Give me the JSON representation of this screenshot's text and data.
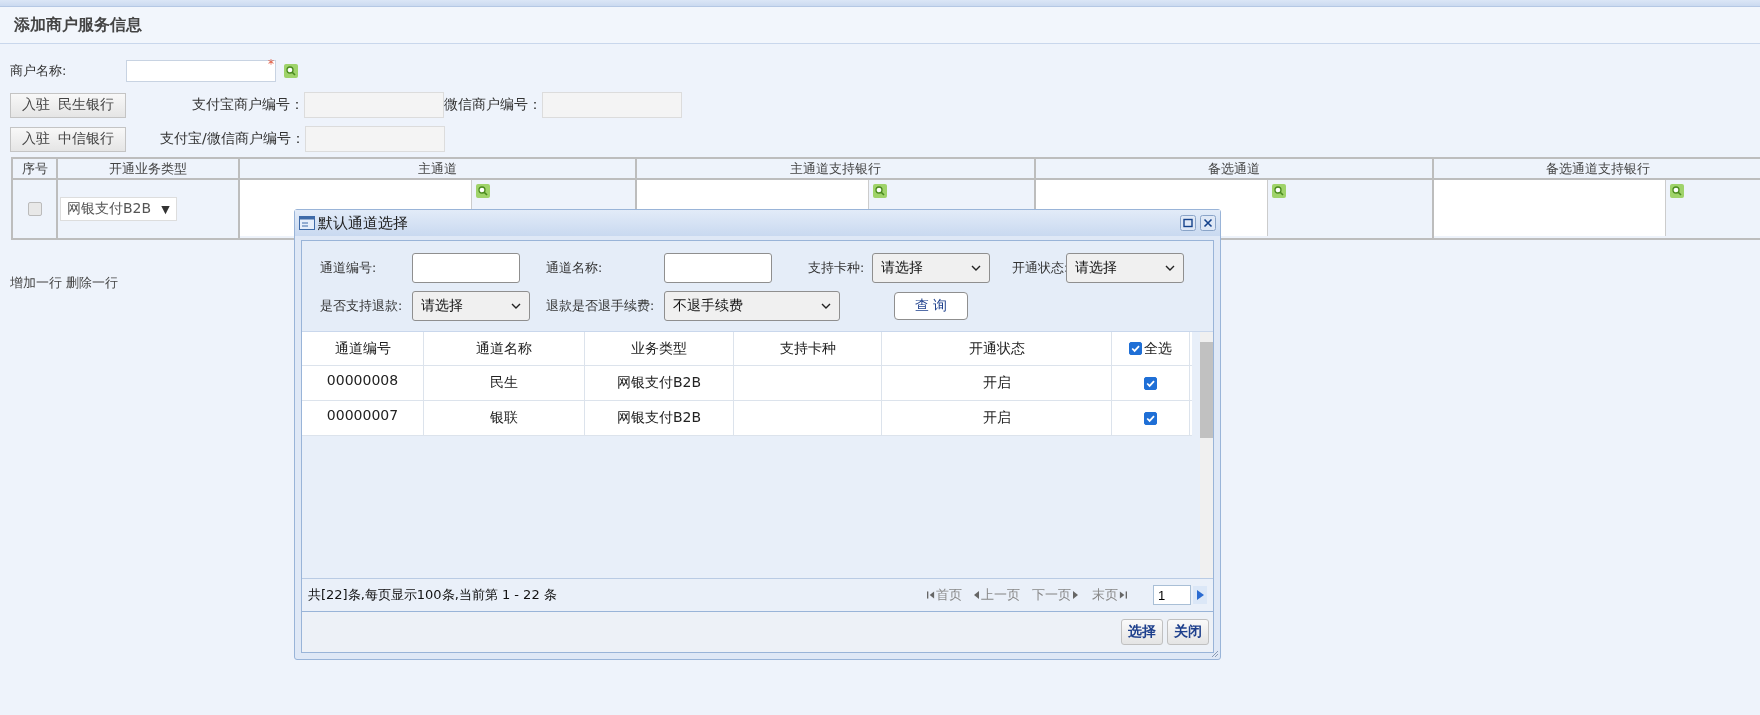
{
  "page_title": "添加商户服务信息",
  "merchant": {
    "label": "商户名称:",
    "required_mark": "*"
  },
  "onboard_rows": [
    {
      "button": "入驻  民生银行",
      "fields": [
        {
          "label": "支付宝商户编号："
        },
        {
          "label": "微信商户编号："
        }
      ]
    },
    {
      "button": "入驻  中信银行",
      "fields": [
        {
          "label": "支付宝/微信商户编号："
        }
      ]
    }
  ],
  "table": {
    "columns": [
      "序号",
      "开通业务类型",
      "主通道",
      "主通道支持银行",
      "备选通道",
      "备选通道支持银行"
    ],
    "rows": [
      {
        "checked": false,
        "business_type": "网银支付B2B",
        "dropdown_mark": "▼"
      }
    ]
  },
  "row_actions": [
    "增加一行",
    "删除一行"
  ],
  "dialog": {
    "title": "默认通道选择",
    "filters": [
      {
        "label": "通道编号:",
        "kind": "text"
      },
      {
        "label": "通道名称:",
        "kind": "text"
      },
      {
        "label": "支持卡种:",
        "kind": "select",
        "value": "请选择"
      },
      {
        "label": "开通状态:",
        "kind": "select",
        "value": "请选择"
      },
      {
        "label": "是否支持退款:",
        "kind": "select",
        "value": "请选择"
      },
      {
        "label": "退款是否退手续费:",
        "kind": "select",
        "value": "不退手续费"
      }
    ],
    "query_button": "查 询",
    "grid": {
      "columns": [
        "通道编号",
        "通道名称",
        "业务类型",
        "支持卡种",
        "开通状态"
      ],
      "select_all": {
        "label": "全选",
        "checked": true
      },
      "rows": [
        {
          "cells": [
            "00000008",
            "民生",
            "网银支付B2B",
            "",
            "开启"
          ],
          "checked": true
        },
        {
          "cells": [
            "00000007",
            "银联",
            "网银支付B2B",
            "",
            "开启"
          ],
          "checked": true
        }
      ]
    },
    "summary": "共[22]条,每页显示100条,当前第 1 - 22 条",
    "pager": {
      "first": "首页",
      "prev": "上一页",
      "next": "下一页",
      "last": "末页",
      "page": "1"
    },
    "buttons": [
      "选择",
      "关闭"
    ]
  }
}
